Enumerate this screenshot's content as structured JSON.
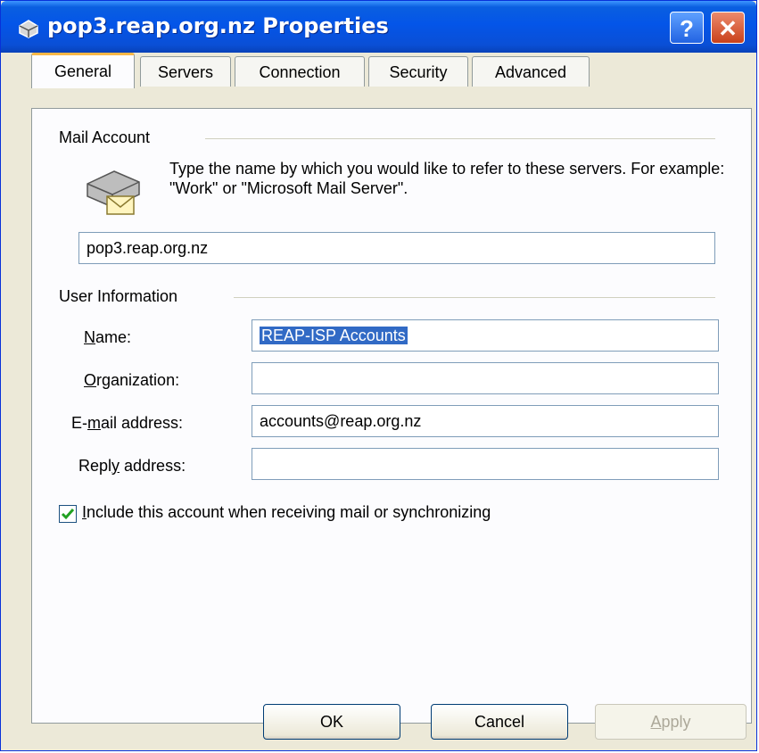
{
  "window": {
    "title": "pop3.reap.org.nz Properties",
    "help_label": "?",
    "close_label": "✕"
  },
  "tabs": [
    {
      "label": "General"
    },
    {
      "label": "Servers"
    },
    {
      "label": "Connection"
    },
    {
      "label": "Security"
    },
    {
      "label": "Advanced"
    }
  ],
  "mail_account": {
    "heading": "Mail Account",
    "description": "Type the name by which you would like to refer to these servers.  For example: \"Work\" or \"Microsoft Mail Server\".",
    "account_name_value": "pop3.reap.org.nz"
  },
  "user_info": {
    "heading": "User Information",
    "name_label_u": "N",
    "name_label_rest": "ame:",
    "name_value": "REAP-ISP Accounts",
    "org_label_u": "O",
    "org_label_rest": "rganization:",
    "org_value": "",
    "email_label_pre": "E-",
    "email_label_u": "m",
    "email_label_rest": "ail address:",
    "email_value": "accounts@reap.org.nz",
    "reply_label_pre": "Repl",
    "reply_label_u": "y",
    "reply_label_rest": " address:",
    "reply_value": ""
  },
  "include_checkbox": {
    "checked": true,
    "label_u": "I",
    "label_rest": "nclude this account when receiving mail or synchronizing"
  },
  "buttons": {
    "ok_label": "OK",
    "cancel_label": "Cancel",
    "apply_label_u": "A",
    "apply_label_rest": "pply"
  },
  "colors": {
    "titlebar": "#0455e8",
    "selection": "#316ac5",
    "tab_highlight": "#f9b747",
    "dialog_bg": "#ece9d8"
  }
}
